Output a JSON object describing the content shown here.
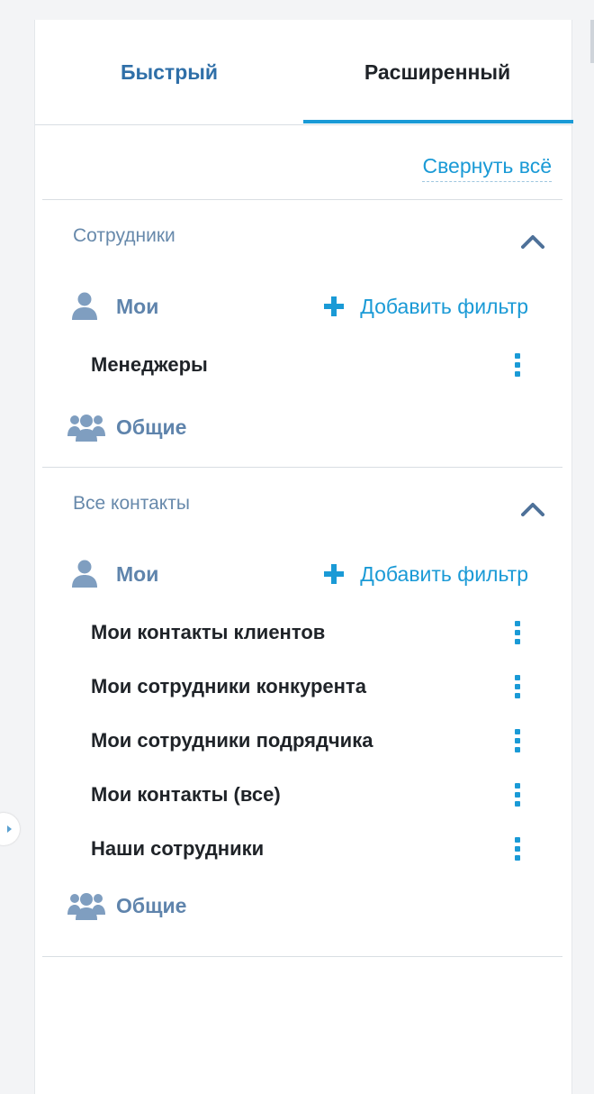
{
  "tabs": [
    {
      "label": "Быстрый"
    },
    {
      "label": "Расширенный"
    }
  ],
  "collapse_all_label": "Свернуть всё",
  "sections": [
    {
      "title": "Сотрудники",
      "mine_label": "Мои",
      "add_filter_label": "Добавить фильтр",
      "filters": [
        "Менеджеры"
      ],
      "shared_label": "Общие"
    },
    {
      "title": "Все контакты",
      "mine_label": "Мои",
      "add_filter_label": "Добавить фильтр",
      "filters": [
        "Мои контакты клиентов",
        "Мои сотрудники конкурента",
        "Мои сотрудники подрядчика",
        "Мои контакты (все)",
        "Наши сотрудники"
      ],
      "shared_label": "Общие"
    }
  ],
  "icons": {
    "user": "user-icon",
    "group": "users-group-icon",
    "plus": "plus-icon",
    "kebab": "kebab-menu-icon",
    "chevron": "chevron-up-icon",
    "expand": "chevron-right-icon"
  },
  "colors": {
    "accent": "#1a9ad6",
    "muted_blue": "#5f84ac",
    "text": "#1f2328",
    "divider": "#d9dee3"
  }
}
